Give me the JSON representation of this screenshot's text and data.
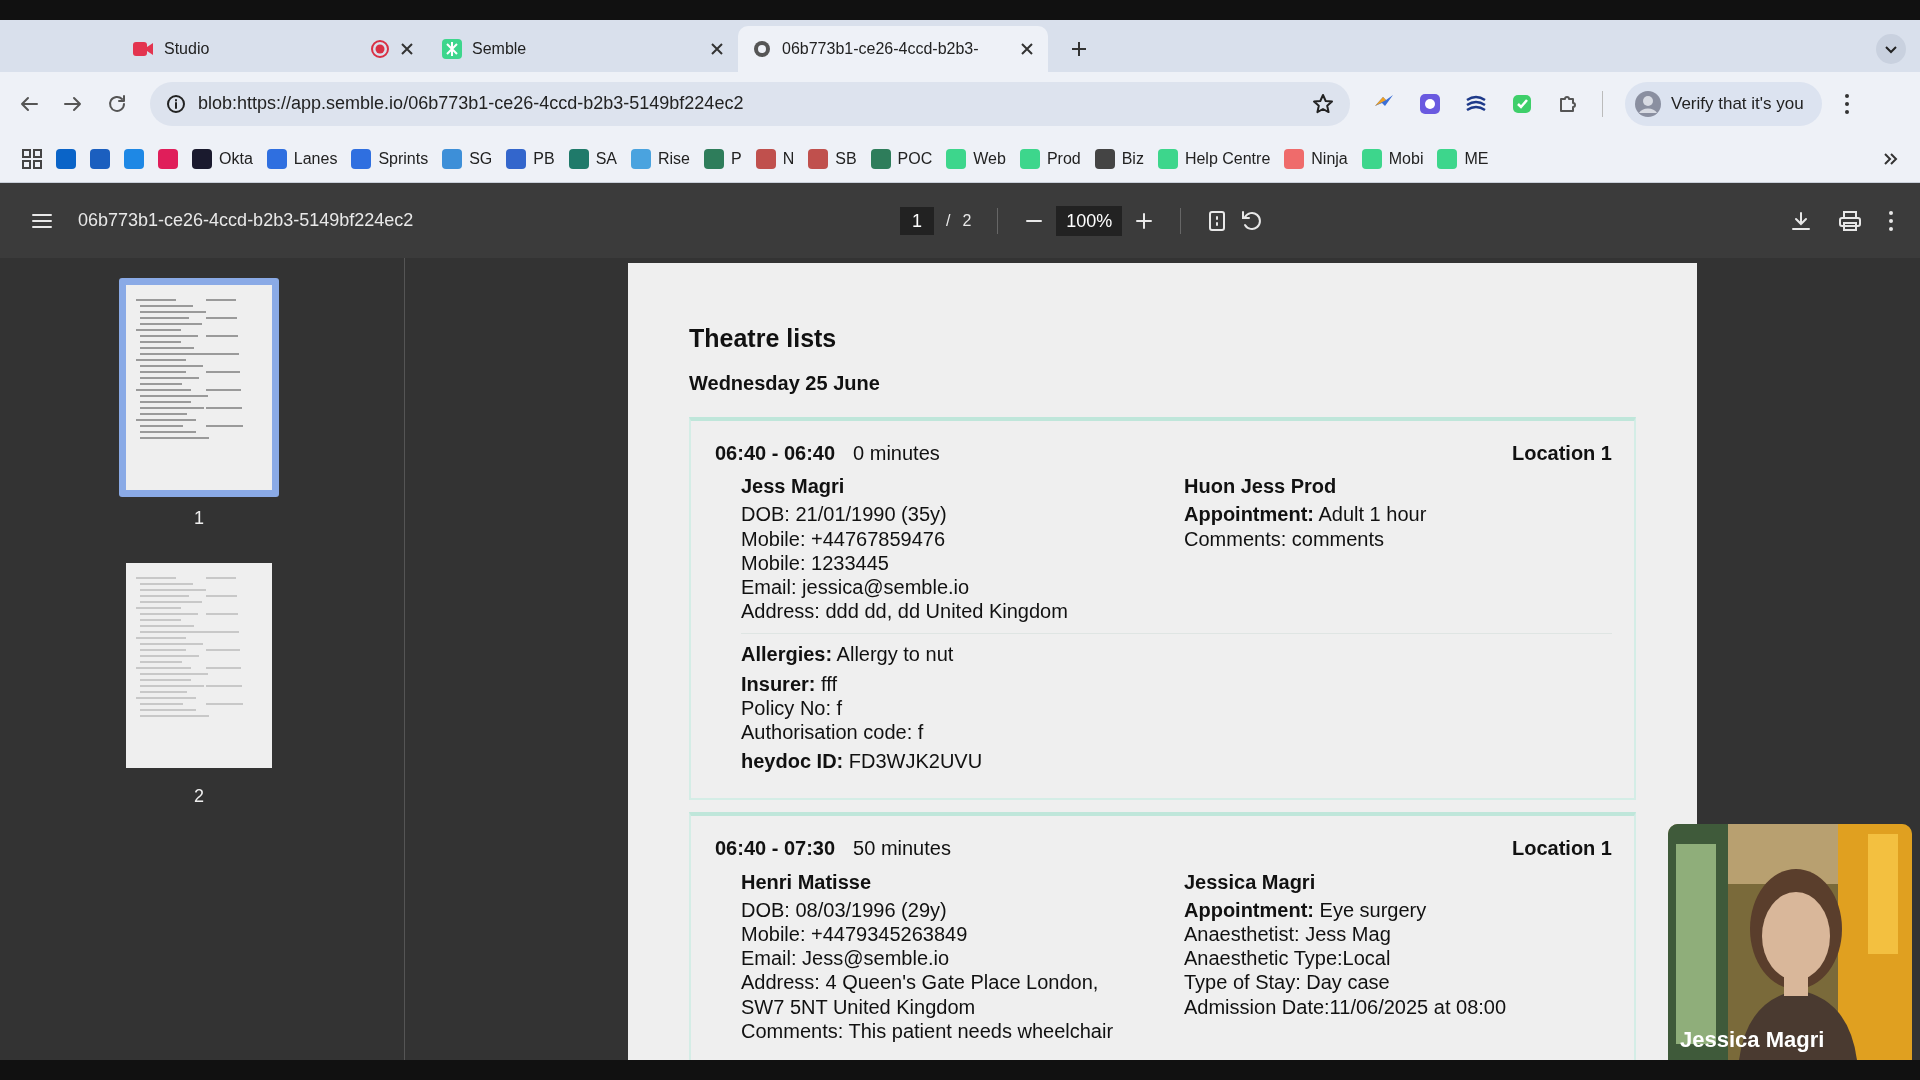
{
  "tabs": [
    {
      "title": "Studio",
      "kind": "studio",
      "recording": true,
      "selected": false
    },
    {
      "title": "Semble",
      "kind": "semble",
      "recording": false,
      "selected": false
    },
    {
      "title": "06b773b1-ce26-4ccd-b2b3-",
      "kind": "page",
      "recording": false,
      "selected": true
    }
  ],
  "address_bar": {
    "url": "blob:https://app.semble.io/06b773b1-ce26-4ccd-b2b3-5149bf224ec2"
  },
  "profile_button": {
    "label": "Verify that it's you"
  },
  "bookmarks": [
    {
      "color": "#0a64c8"
    },
    {
      "color": "#1b5fbf"
    },
    {
      "color": "#1e88e5"
    },
    {
      "color": "#e01e5a"
    },
    {
      "label": "Okta",
      "color": "#1a1a2e"
    },
    {
      "label": "Lanes",
      "color": "#2f6fe0"
    },
    {
      "label": "Sprints",
      "color": "#2f6fe0"
    },
    {
      "label": "SG",
      "color": "#3d8fd8"
    },
    {
      "label": "PB",
      "color": "#3366cc"
    },
    {
      "label": "SA",
      "color": "#1f7a6a"
    },
    {
      "label": "Rise",
      "color": "#4aa3df"
    },
    {
      "label": "P",
      "color": "#2e7d5b"
    },
    {
      "label": "N",
      "color": "#c0504d"
    },
    {
      "label": "SB",
      "color": "#c0504d"
    },
    {
      "label": "POC",
      "color": "#2e7d5b"
    },
    {
      "label": "Web",
      "color": "#3dd68c"
    },
    {
      "label": "Prod",
      "color": "#3dd68c"
    },
    {
      "label": "Biz",
      "color": "#444444"
    },
    {
      "label": "Help Centre",
      "color": "#3dd68c"
    },
    {
      "label": "Ninja",
      "color": "#ef6b6b"
    },
    {
      "label": "Mobi",
      "color": "#3dd68c"
    },
    {
      "label": "ME",
      "color": "#3dd68c"
    }
  ],
  "pdf_toolbar": {
    "filename": "06b773b1-ce26-4ccd-b2b3-5149bf224ec2",
    "page": "1",
    "separator": "/",
    "page_count": "2",
    "zoom": "100%"
  },
  "thumbnails": [
    {
      "label": "1",
      "selected": true
    },
    {
      "label": "2",
      "selected": false
    }
  ],
  "document": {
    "title": "Theatre lists",
    "date": "Wednesday 25 June",
    "appointments": [
      {
        "time": "06:40 - 06:40",
        "duration": "0 minutes",
        "location": "Location 1",
        "patient": {
          "name": "Jess Magri",
          "lines": [
            "DOB: 21/01/1990 (35y)",
            "Mobile: +44767859476",
            "Mobile: 1233445",
            "Email: jessica@semble.io",
            "Address: ddd dd, dd United Kingdom"
          ]
        },
        "clinician": {
          "name": "Huon Jess Prod",
          "lines": [
            "**Appointment:** Adult 1 hour",
            "Comments: comments"
          ]
        },
        "details": [
          [
            "**Allergies:** Allergy to nut"
          ],
          [
            "**Insurer:** fff",
            "Policy No: f",
            "Authorisation code: f"
          ],
          [
            "**heydoc ID:** FD3WJK2UVU"
          ]
        ]
      },
      {
        "time": "06:40 - 07:30",
        "duration": "50 minutes",
        "location": "Location 1",
        "patient": {
          "name": "Henri Matisse",
          "lines": [
            "DOB: 08/03/1996 (29y)",
            "Mobile: +4479345263849",
            "Email: Jess@semble.io",
            "Address: 4 Queen's Gate Place London, SW7 5NT United Kingdom",
            "Comments: This patient needs wheelchair"
          ]
        },
        "clinician": {
          "name": "Jessica Magri",
          "lines": [
            "**Appointment:** Eye surgery",
            "Anaesthetist: Jess Mag",
            "Anaesthetic Type:Local",
            "Type of Stay: Day case",
            "Admission Date:11/06/2025 at 08:00"
          ]
        }
      }
    ]
  },
  "webcam": {
    "kind": "picture",
    "name": "Jessica Magri"
  }
}
